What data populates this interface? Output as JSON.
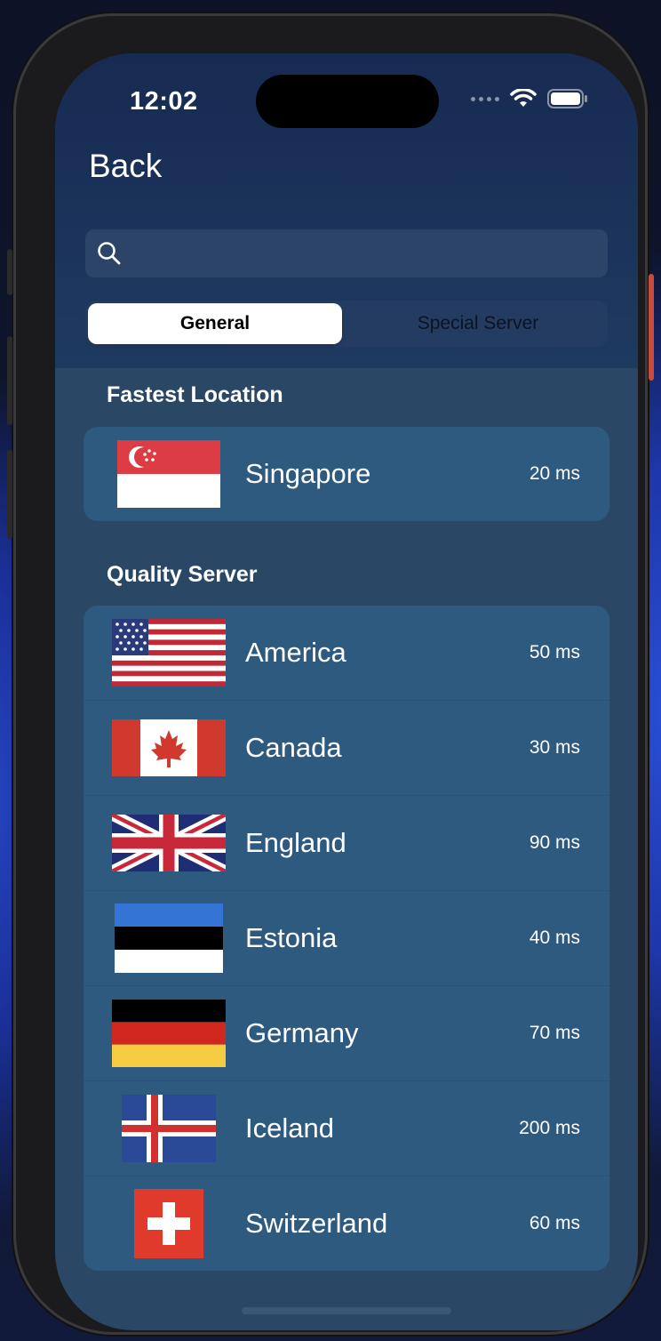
{
  "status": {
    "time": "12:02"
  },
  "nav": {
    "back_label": "Back"
  },
  "search": {
    "placeholder": ""
  },
  "tabs": [
    {
      "label": "General",
      "selected": true
    },
    {
      "label": "Special Server",
      "selected": false
    }
  ],
  "fastest": {
    "title": "Fastest Location",
    "items": [
      {
        "name": "Singapore",
        "ping": "20 ms",
        "flag": "singapore-flag"
      }
    ]
  },
  "quality": {
    "title": "Quality Server",
    "items": [
      {
        "name": "America",
        "ping": "50 ms",
        "flag": "usa-flag"
      },
      {
        "name": "Canada",
        "ping": "30 ms",
        "flag": "canada-flag"
      },
      {
        "name": "England",
        "ping": "90 ms",
        "flag": "uk-flag"
      },
      {
        "name": "Estonia",
        "ping": "40 ms",
        "flag": "estonia-flag"
      },
      {
        "name": "Germany",
        "ping": "70 ms",
        "flag": "germany-flag"
      },
      {
        "name": "Iceland",
        "ping": "200 ms",
        "flag": "iceland-flag"
      },
      {
        "name": "Switzerland",
        "ping": "60 ms",
        "flag": "switzerland-flag"
      }
    ]
  },
  "colors": {
    "card": "#2e5a80",
    "screen_bg": "#2a4766",
    "header_bg": "#172a52"
  }
}
